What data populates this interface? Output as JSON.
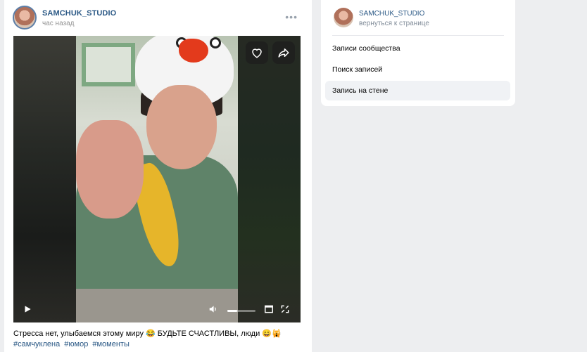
{
  "post": {
    "author": "SAMCHUK_STUDIO",
    "time": "час назад",
    "more_label": "•••",
    "caption": "Стресса нет, улыбаемся этому миру 😂 БУДЬТЕ СЧАСТЛИВЫ, люди 😄🙀",
    "hashtags": [
      "#самчуклена",
      "#юмор",
      "#моменты"
    ],
    "video": {
      "volume_level": 0.35,
      "icons": [
        "heart-icon",
        "share-icon",
        "play-icon",
        "volume-icon",
        "miniplayer-icon",
        "fullscreen-icon"
      ]
    }
  },
  "sidebar": {
    "name": "SAMCHUK_STUDIO",
    "back_link": "вернуться к странице",
    "items": [
      {
        "label": "Записи сообщества",
        "active": false
      },
      {
        "label": "Поиск записей",
        "active": false
      },
      {
        "label": "Запись на стене",
        "active": true
      }
    ]
  },
  "colors": {
    "link": "#2a5885",
    "background": "#edeef0",
    "active_item": "#f0f2f5"
  }
}
